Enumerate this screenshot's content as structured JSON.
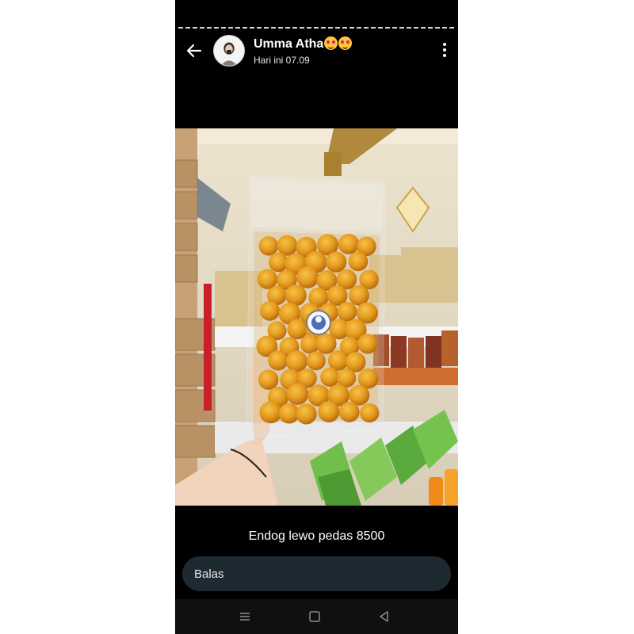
{
  "status": {
    "contact_name": "Umma Atha",
    "name_emojis": [
      "smiling-face-with-hearts-emoji",
      "smiling-face-with-hearts-emoji"
    ],
    "timestamp": "Hari ini 07.09",
    "caption": "Endog lewo pedas 8500",
    "progress_segments": 1
  },
  "reply": {
    "placeholder": "Balas"
  },
  "navigation": {
    "buttons": [
      "menu-icon",
      "home-icon",
      "back-triangle-icon"
    ]
  }
}
